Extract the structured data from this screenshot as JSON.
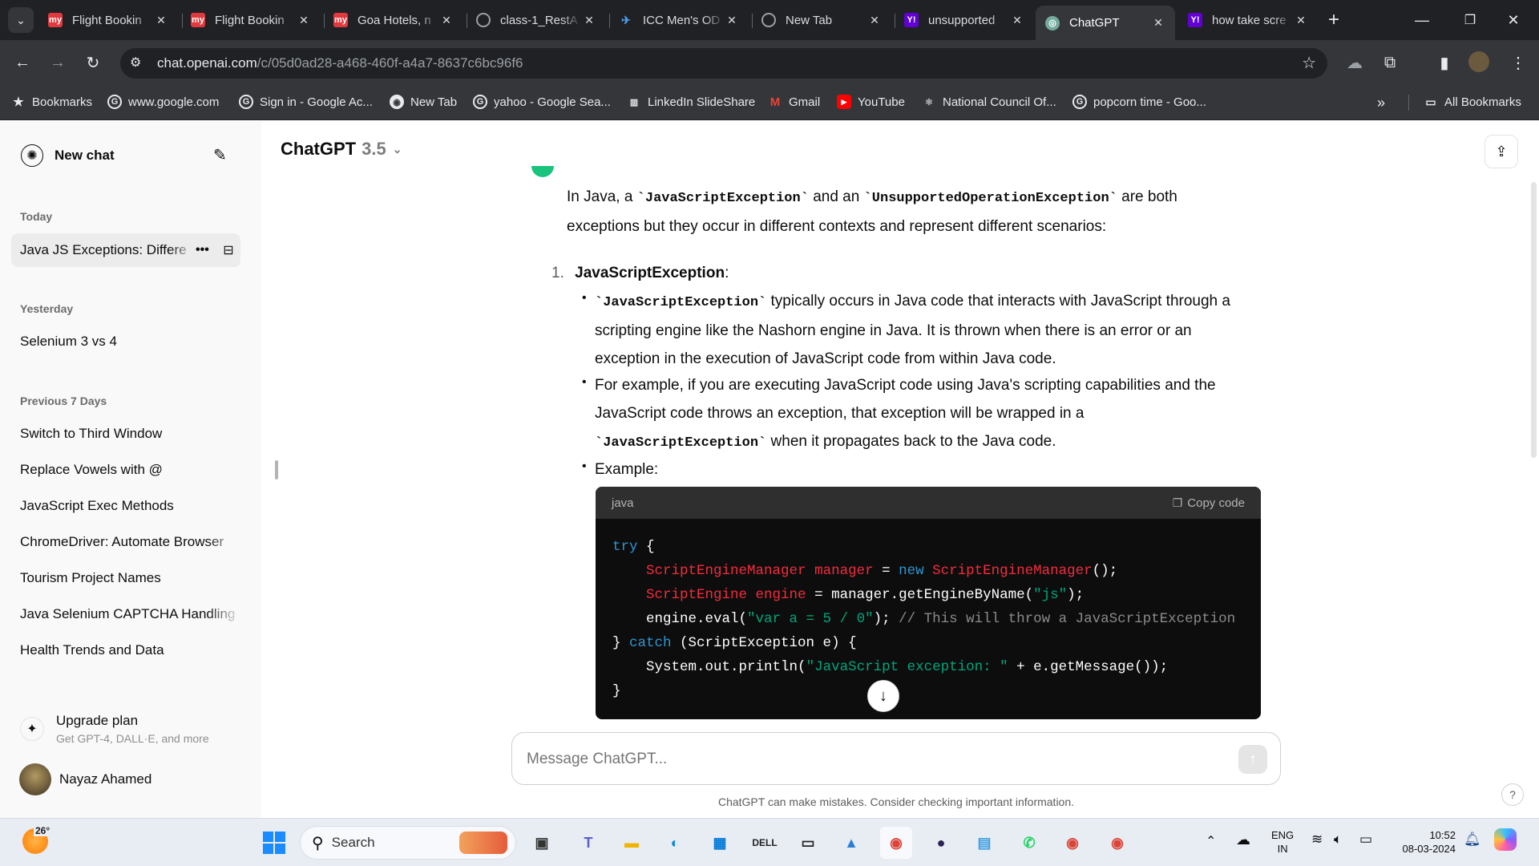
{
  "browser": {
    "tabs": [
      {
        "title": "Flight Bookin",
        "icon": "mmt-icon",
        "color": "#e03a3e"
      },
      {
        "title": "Flight Bookin",
        "icon": "mmt-icon",
        "color": "#e03a3e"
      },
      {
        "title": "Goa Hotels, n",
        "icon": "mmt-icon",
        "color": "#e03a3e"
      },
      {
        "title": "class-1_RestA",
        "icon": "globe-icon",
        "color": "#9aa0a6"
      },
      {
        "title": "ICC Men's OD",
        "icon": "icc-icon",
        "color": "#4a9be8"
      },
      {
        "title": "New Tab",
        "icon": "globe-icon",
        "color": "#9aa0a6"
      },
      {
        "title": "unsupported",
        "icon": "yahoo-icon",
        "color": "#6001d2"
      },
      {
        "title": "ChatGPT",
        "icon": "chatgpt-icon",
        "color": "#74aa9c",
        "active": true
      },
      {
        "title": "how take scre",
        "icon": "yahoo-icon",
        "color": "#6001d2"
      }
    ],
    "url_host": "chat.openai.com",
    "url_path": "/c/05d0ad28-a468-460f-a4a7-8637c6bc96f6",
    "bookmarks": [
      {
        "label": "Bookmarks",
        "icon": "star-icon"
      },
      {
        "label": "www.google.com",
        "icon": "google-icon"
      },
      {
        "label": "Sign in - Google Ac...",
        "icon": "google-icon"
      },
      {
        "label": "New Tab",
        "icon": "chrome-icon"
      },
      {
        "label": "yahoo - Google Sea...",
        "icon": "google-icon"
      },
      {
        "label": "LinkedIn SlideShare",
        "icon": "slideshare-icon"
      },
      {
        "label": "Gmail",
        "icon": "gmail-icon"
      },
      {
        "label": "YouTube",
        "icon": "youtube-icon"
      },
      {
        "label": "National Council Of...",
        "icon": "ncert-icon"
      },
      {
        "label": "popcorn time - Goo...",
        "icon": "google-icon"
      }
    ],
    "all_bookmarks": "All Bookmarks"
  },
  "sidebar": {
    "new_chat": "New chat",
    "today": "Today",
    "today_items": [
      "Java JS Exceptions: Differe"
    ],
    "yesterday": "Yesterday",
    "yesterday_items": [
      "Selenium 3 vs 4"
    ],
    "prev7": "Previous 7 Days",
    "prev7_items": [
      "Switch to Third Window",
      "Replace Vowels with @",
      "JavaScript Exec Methods",
      "ChromeDriver: Automate Browser",
      "Tourism Project Names",
      "Java Selenium CAPTCHA Handling",
      "Health Trends and Data"
    ],
    "upgrade_title": "Upgrade plan",
    "upgrade_sub": "Get GPT-4, DALL·E, and more",
    "user_name": "Nayaz Ahamed"
  },
  "header": {
    "model": "ChatGPT",
    "version": "3.5"
  },
  "message": {
    "intro_pre": "In Java, a ",
    "intro_code1": "`JavaScriptException`",
    "intro_mid": " and an ",
    "intro_code2": "`UnsupportedOperationException`",
    "intro_post": " are both",
    "intro_line2": "exceptions but they occur in different contexts and represent different scenarios:",
    "item_number": "1.",
    "item_title": "JavaScriptException",
    "item_colon": ":",
    "b1_code": "`JavaScriptException`",
    "b1_l1": " typically occurs in Java code that interacts with JavaScript through a",
    "b1_l2": "scripting engine like the Nashorn engine in Java. It is thrown when there is an error or an",
    "b1_l3": "exception in the execution of JavaScript code from within Java code.",
    "b2_l1": "For example, if you are executing JavaScript code using Java's scripting capabilities and the",
    "b2_l2": "JavaScript code throws an exception, that exception will be wrapped in a",
    "b2_code": "`JavaScriptException`",
    "b2_l3": " when it propagates back to the Java code.",
    "b3": "Example:"
  },
  "code": {
    "lang": "java",
    "copy": "Copy code",
    "l1_kw": "try",
    "l1_rest": " {",
    "l2_t1": "ScriptEngineManager",
    "l2_v": " manager",
    "l2_eq": " = ",
    "l2_new": "new",
    "l2_t2": " ScriptEngineManager",
    "l2_end": "();",
    "l3_t1": "ScriptEngine",
    "l3_v": " engine",
    "l3_mid": " = manager.getEngineByName(",
    "l3_str": "\"js\"",
    "l3_end": ");",
    "l4_pre": "engine.eval(",
    "l4_str": "\"var a = 5 / 0\"",
    "l4_mid": "); ",
    "l4_cm": "// This will throw a JavaScriptException",
    "l5_pre": "} ",
    "l5_kw": "catch",
    "l5_rest": " (ScriptException e) {",
    "l6_pre": "System.out.println(",
    "l6_str": "\"JavaScript exception: \"",
    "l6_rest": " + e.getMessage());",
    "l7": "}"
  },
  "composer": {
    "placeholder": "Message ChatGPT..."
  },
  "disclaimer": "ChatGPT can make mistakes. Consider checking important information.",
  "help": "?",
  "taskbar": {
    "weather_temp": "26°",
    "search": "Search",
    "lang1": "ENG",
    "lang2": "IN",
    "time": "10:52",
    "date": "08-03-2024"
  }
}
